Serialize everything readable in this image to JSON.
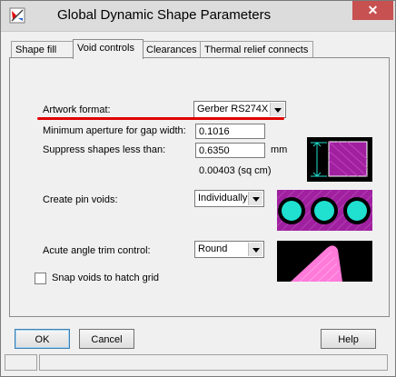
{
  "window": {
    "title": "Global Dynamic Shape Parameters",
    "close_glyph": "✕"
  },
  "tabs": [
    {
      "label": "Shape fill"
    },
    {
      "label": "Void controls"
    },
    {
      "label": "Clearances"
    },
    {
      "label": "Thermal relief connects"
    }
  ],
  "active_tab": "Void controls",
  "void_controls": {
    "artwork_format_label": "Artwork format:",
    "artwork_format_value": "Gerber RS274X",
    "min_aperture_label": "Minimum aperture for gap width:",
    "min_aperture_value": "0.1016",
    "suppress_label": "Suppress shapes less than:",
    "suppress_value": "0.6350",
    "suppress_unit": "mm",
    "area_readout": "0.00403 (sq cm)",
    "pin_voids_label": "Create pin voids:",
    "pin_voids_value": "Individually",
    "acute_trim_label": "Acute angle trim control:",
    "acute_trim_value": "Round",
    "snap_label": "Snap voids to hatch grid",
    "snap_checked": false
  },
  "buttons": {
    "ok": "OK",
    "cancel": "Cancel",
    "help": "Help"
  },
  "colors": {
    "highlight_line": "#e00000",
    "preview_magenta": "#a020a0",
    "preview_cyan": "#20e0d0",
    "preview_pink": "#ff7ad9",
    "preview_bg": "#000000"
  }
}
